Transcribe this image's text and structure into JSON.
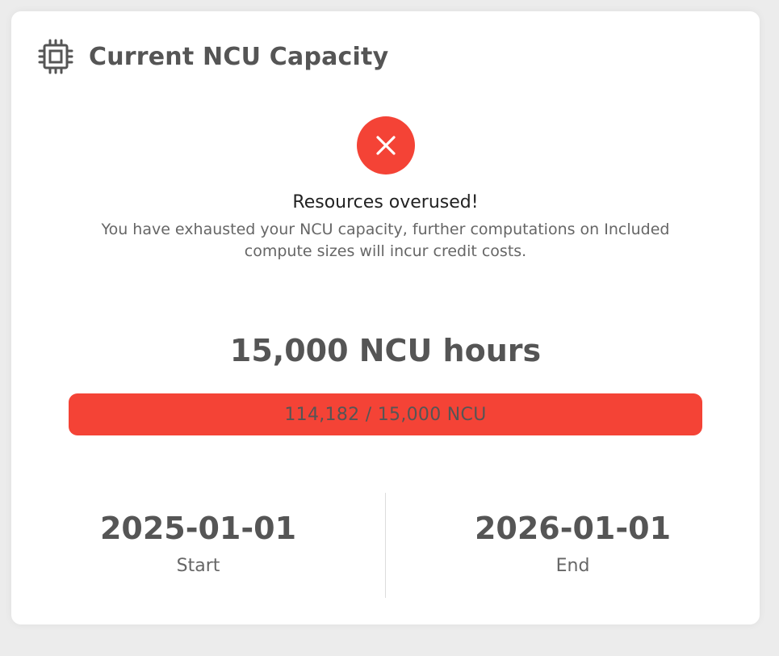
{
  "card": {
    "title": "Current NCU Capacity",
    "icon": "cpu-chip-icon"
  },
  "status": {
    "icon": "close-x-icon",
    "icon_color": "#f44336",
    "headline": "Resources overused!",
    "description": "You have exhausted your NCU capacity, further computations on Included compute sizes will incur credit costs."
  },
  "capacity": {
    "hours_label": "15,000 NCU hours",
    "usage_label": "114,182 / 15,000 NCU",
    "used": 114182,
    "total": 15000,
    "fill_fraction": 1.0,
    "bar_color": "#f44336"
  },
  "period": {
    "start_value": "2025-01-01",
    "start_label": "Start",
    "end_value": "2026-01-01",
    "end_label": "End"
  }
}
